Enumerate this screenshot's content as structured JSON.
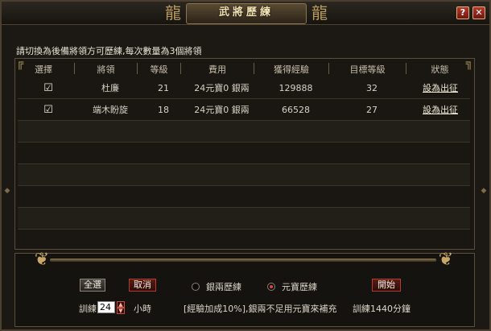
{
  "window": {
    "title": "武將歷練",
    "help_label": "?",
    "close_label": "✕"
  },
  "hint": "請切換為後備將領方可歷練,每次數量為3個將領",
  "table": {
    "headers": [
      "選擇",
      "將領",
      "等級",
      "費用",
      "獲得經驗",
      "目標等級",
      "狀態"
    ],
    "rows": [
      {
        "check": "☑",
        "name": "杜廉",
        "level": "21",
        "cost": "24元寶0 銀兩",
        "exp": "129888",
        "target": "32",
        "action": "設為出征"
      },
      {
        "check": "☑",
        "name": "端木盼旋",
        "level": "18",
        "cost": "24元寶0 銀兩",
        "exp": "66528",
        "target": "27",
        "action": "設為出征"
      }
    ]
  },
  "controls": {
    "select_all": "全選",
    "cancel": "取消",
    "radio_silver": "銀兩歷練",
    "radio_yuanbao": "元寶歷練",
    "selected_radio": "yuanbao",
    "start": "開始",
    "train_label": "訓練",
    "hours_value": "24",
    "hours_unit": "小時",
    "notice": "[經驗加成10%],銀兩不足用元寶來補充",
    "train_total": "訓練1440分鐘"
  },
  "colors": {
    "accent_red": "#b63a2e",
    "gold": "#c7a868",
    "background": "#1c1914"
  }
}
